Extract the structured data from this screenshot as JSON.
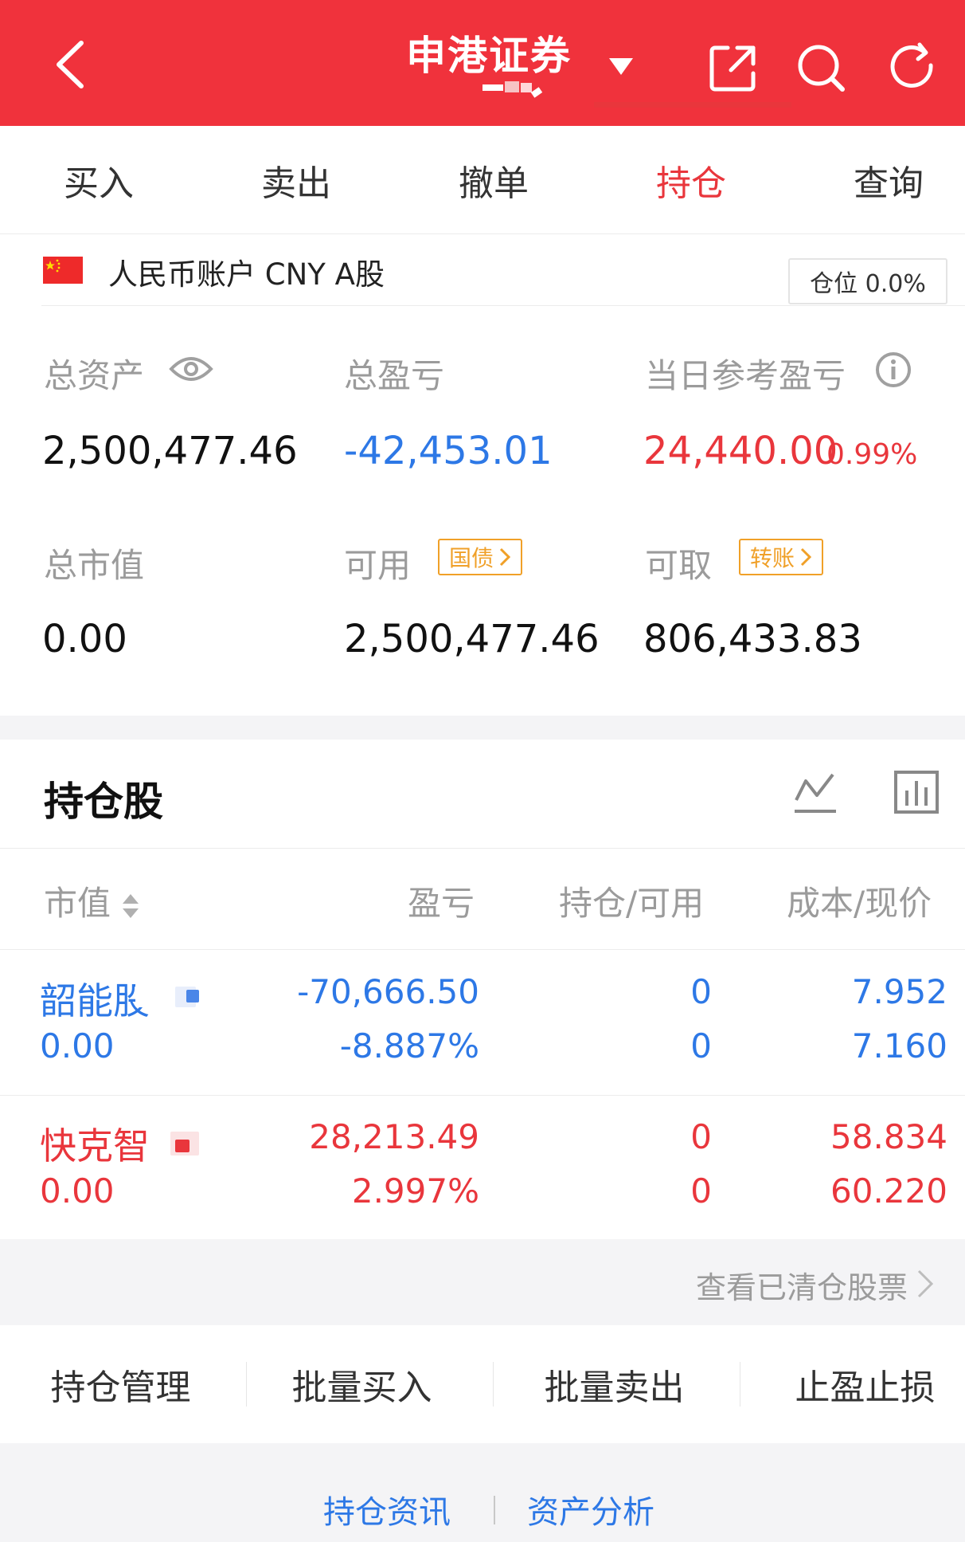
{
  "header": {
    "title": "申港证券",
    "bg_color": "#f0323c",
    "icons": [
      "back-arrow-icon",
      "caret-down-icon",
      "share-icon",
      "search-icon",
      "refresh-icon"
    ]
  },
  "tabs": [
    {
      "label": "买入",
      "active": false
    },
    {
      "label": "卖出",
      "active": false
    },
    {
      "label": "撤单",
      "active": false
    },
    {
      "label": "持仓",
      "active": true
    },
    {
      "label": "查询",
      "active": false
    }
  ],
  "account": {
    "label": "人民币账户 CNY A股",
    "position_ratio": "仓位 0.0%"
  },
  "summary": {
    "total_assets_label": "总资产",
    "total_assets": "2,500,477.46",
    "total_pnl_label": "总盈亏",
    "total_pnl": "-42,453.01",
    "daily_pnl_label": "当日参考盈亏",
    "daily_pnl": "24,440.00",
    "daily_pnl_pct": "0.99%",
    "market_value_label": "总市值",
    "market_value": "0.00",
    "available_label": "可用",
    "available_tag": "国债",
    "available": "2,500,477.46",
    "withdrawable_label": "可取",
    "withdrawable_tag": "转账",
    "withdrawable": "806,433.83"
  },
  "holdings": {
    "title": "持仓股",
    "columns": [
      "市值",
      "盈亏",
      "持仓/可用",
      "成本/现价"
    ],
    "rows": [
      {
        "name": "韶能股",
        "market_value": "0.00",
        "pnl": "-70,666.50",
        "pnl_pct": "-8.887%",
        "position": "0",
        "available": "0",
        "cost": "7.952",
        "price": "7.160",
        "color": "#2d78e6"
      },
      {
        "name": "快克智",
        "market_value": "0.00",
        "pnl": "28,213.49",
        "pnl_pct": "2.997%",
        "position": "0",
        "available": "0",
        "cost": "58.834",
        "price": "60.220",
        "color": "#e9363c"
      }
    ],
    "cleared_link": "查看已清仓股票"
  },
  "actions": [
    "持仓管理",
    "批量买入",
    "批量卖出",
    "止盈止损"
  ],
  "footer": {
    "links": [
      "持仓资讯",
      "资产分析"
    ]
  },
  "colors": {
    "accent_red": "#e9363c",
    "loss_blue": "#2d78e6",
    "tag_orange": "#f0a028",
    "label_gray": "#9b9b9b"
  }
}
